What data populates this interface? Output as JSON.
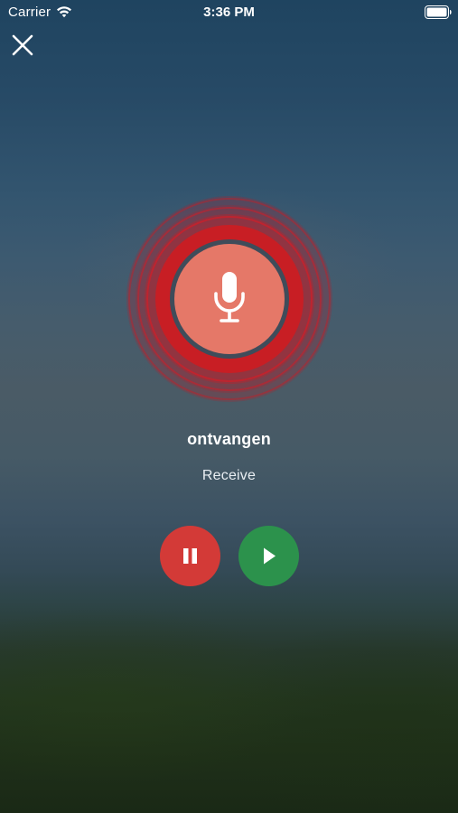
{
  "status_bar": {
    "carrier": "Carrier",
    "time": "3:36 PM",
    "wifi_icon": "wifi-icon",
    "battery_icon": "battery-icon"
  },
  "close_icon": "close-icon",
  "recording": {
    "mic_icon": "microphone-icon",
    "word": "ontvangen",
    "translation": "Receive"
  },
  "controls": {
    "pause_icon": "pause-icon",
    "play_icon": "play-icon"
  },
  "colors": {
    "mic_fill": "#e57868",
    "ring_red": "#c81e24",
    "pause_button": "#d33a37",
    "play_button": "#2c924c"
  }
}
